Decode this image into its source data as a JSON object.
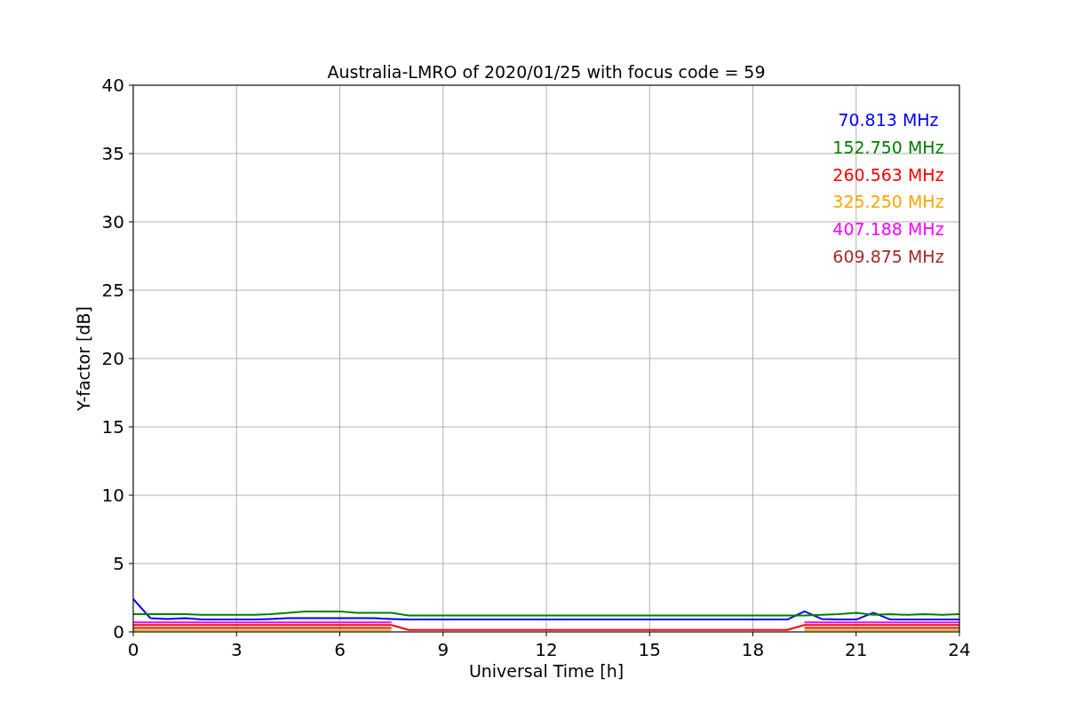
{
  "chart_data": {
    "type": "line",
    "title": "Australia-LMRO of 2020/01/25 with focus code = 59",
    "xlabel": "Universal Time [h]",
    "ylabel": "Y-factor [dB]",
    "xlim": [
      0,
      24
    ],
    "ylim": [
      0,
      40
    ],
    "xticks": [
      0,
      3,
      6,
      9,
      12,
      15,
      18,
      21,
      24
    ],
    "yticks": [
      0,
      5,
      10,
      15,
      20,
      25,
      30,
      35,
      40
    ],
    "grid": true,
    "x": [
      0,
      0.5,
      1,
      1.5,
      2,
      2.5,
      3,
      3.5,
      4,
      4.5,
      5,
      5.5,
      6,
      6.5,
      7,
      7.5,
      8,
      8.5,
      9,
      9.5,
      10,
      10.5,
      11,
      11.5,
      12,
      12.5,
      13,
      13.5,
      14,
      14.5,
      15,
      15.5,
      16,
      16.5,
      17,
      17.5,
      18,
      18.5,
      19,
      19.5,
      20,
      20.5,
      21,
      21.5,
      22,
      22.5,
      23,
      23.5,
      24
    ],
    "series": [
      {
        "name": "70.813 MHz",
        "color": "#0000ff",
        "values": [
          2.4,
          1.0,
          0.95,
          1.0,
          0.9,
          0.9,
          0.9,
          0.9,
          0.95,
          1.0,
          1.0,
          1.0,
          1.0,
          1.0,
          1.0,
          0.95,
          0.9,
          0.9,
          0.9,
          0.9,
          0.9,
          0.9,
          0.9,
          0.9,
          0.9,
          0.9,
          0.9,
          0.9,
          0.9,
          0.9,
          0.9,
          0.9,
          0.9,
          0.9,
          0.9,
          0.9,
          0.9,
          0.9,
          0.9,
          1.5,
          0.95,
          0.9,
          0.9,
          1.4,
          0.9,
          0.9,
          0.9,
          0.9,
          0.9
        ]
      },
      {
        "name": "152.750 MHz",
        "color": "#008000",
        "values": [
          1.3,
          1.3,
          1.3,
          1.3,
          1.25,
          1.25,
          1.25,
          1.25,
          1.3,
          1.4,
          1.5,
          1.5,
          1.5,
          1.4,
          1.4,
          1.4,
          1.2,
          1.2,
          1.2,
          1.2,
          1.2,
          1.2,
          1.2,
          1.2,
          1.2,
          1.2,
          1.2,
          1.2,
          1.2,
          1.2,
          1.2,
          1.2,
          1.2,
          1.2,
          1.2,
          1.2,
          1.2,
          1.2,
          1.2,
          1.2,
          1.25,
          1.3,
          1.4,
          1.25,
          1.3,
          1.25,
          1.3,
          1.25,
          1.3
        ]
      },
      {
        "name": "260.563 MHz",
        "color": "#ff0000",
        "values": [
          0.5,
          0.5,
          0.5,
          0.5,
          0.5,
          0.5,
          0.5,
          0.5,
          0.5,
          0.5,
          0.5,
          0.5,
          0.5,
          0.5,
          0.5,
          0.5,
          0.15,
          0.15,
          0.15,
          0.15,
          0.15,
          0.15,
          0.15,
          0.15,
          0.15,
          0.15,
          0.15,
          0.15,
          0.15,
          0.15,
          0.15,
          0.15,
          0.15,
          0.15,
          0.15,
          0.15,
          0.15,
          0.15,
          0.15,
          0.5,
          0.5,
          0.5,
          0.5,
          0.5,
          0.5,
          0.5,
          0.5,
          0.5,
          0.5
        ]
      },
      {
        "name": "325.250 MHz",
        "color": "#ffa500",
        "values": [
          0.12,
          0.12,
          0.12,
          0.12,
          0.12,
          0.12,
          0.12,
          0.12,
          0.12,
          0.12,
          0.12,
          0.12,
          0.12,
          0.12,
          0.12,
          0.12,
          null,
          null,
          null,
          null,
          null,
          null,
          null,
          null,
          null,
          null,
          null,
          null,
          null,
          null,
          null,
          null,
          null,
          null,
          null,
          null,
          null,
          null,
          null,
          0.12,
          0.12,
          0.12,
          0.12,
          0.12,
          0.12,
          0.12,
          0.12,
          0.12,
          0.12
        ]
      },
      {
        "name": "407.188 MHz",
        "color": "#ff00ff",
        "values": [
          0.7,
          0.7,
          0.7,
          0.7,
          0.7,
          0.7,
          0.7,
          0.7,
          0.7,
          0.7,
          0.7,
          0.7,
          0.7,
          0.7,
          0.7,
          0.7,
          null,
          null,
          null,
          null,
          null,
          null,
          null,
          null,
          null,
          null,
          null,
          null,
          null,
          null,
          null,
          null,
          null,
          null,
          null,
          null,
          null,
          null,
          null,
          0.7,
          0.7,
          0.7,
          0.7,
          0.7,
          0.7,
          0.7,
          0.7,
          0.7,
          0.7
        ]
      },
      {
        "name": "609.875 MHz",
        "color": "#a52a2a",
        "values": [
          0.3,
          0.3,
          0.3,
          0.3,
          0.3,
          0.3,
          0.3,
          0.3,
          0.3,
          0.3,
          0.3,
          0.3,
          0.3,
          0.3,
          0.3,
          0.3,
          null,
          null,
          null,
          null,
          null,
          null,
          null,
          null,
          null,
          null,
          null,
          null,
          null,
          null,
          null,
          null,
          null,
          null,
          null,
          null,
          null,
          null,
          null,
          0.3,
          0.3,
          0.3,
          0.3,
          0.3,
          0.3,
          0.3,
          0.3,
          0.3,
          0.3
        ]
      }
    ]
  }
}
